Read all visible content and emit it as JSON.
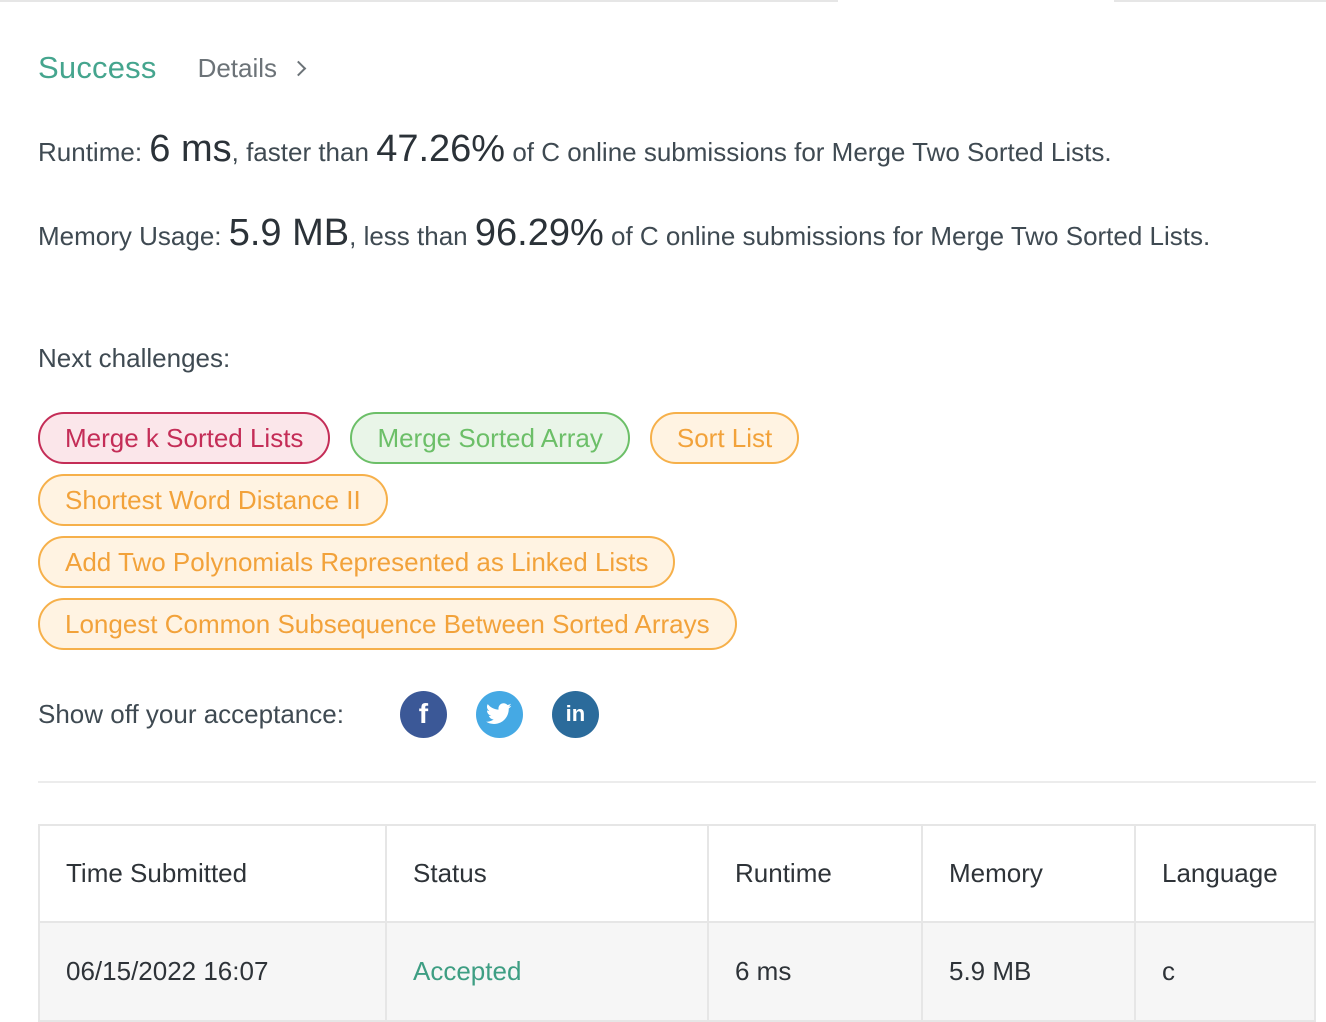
{
  "header": {
    "status": "Success",
    "details_label": "Details"
  },
  "runtime": {
    "label": "Runtime:",
    "value": "6 ms",
    "comparison": ", faster than",
    "percentile": "47.26%",
    "suffix": "of C online submissions for Merge Two Sorted Lists."
  },
  "memory": {
    "label": "Memory Usage:",
    "value": "5.9 MB",
    "comparison": ", less than",
    "percentile": "96.29%",
    "suffix": "of C online submissions for Merge Two Sorted Lists."
  },
  "next_challenges": {
    "label": "Next challenges:",
    "items": [
      {
        "label": "Merge k Sorted Lists",
        "difficulty": "hard"
      },
      {
        "label": "Merge Sorted Array",
        "difficulty": "easy"
      },
      {
        "label": "Sort List",
        "difficulty": "medium"
      },
      {
        "label": "Shortest Word Distance II",
        "difficulty": "medium"
      },
      {
        "label": "Add Two Polynomials Represented as Linked Lists",
        "difficulty": "medium"
      },
      {
        "label": "Longest Common Subsequence Between Sorted Arrays",
        "difficulty": "medium"
      }
    ]
  },
  "share": {
    "label": "Show off your acceptance:",
    "icons": [
      "facebook-icon",
      "twitter-icon",
      "linkedin-icon"
    ],
    "facebook_glyph": "f",
    "linkedin_glyph": "in"
  },
  "colors": {
    "success": "#45a58e",
    "hard": "#c42d57",
    "easy": "#6cbf68",
    "medium": "#f2a23a",
    "facebook": "#3b5897",
    "twitter": "#45a9e4",
    "linkedin": "#2b6b9b"
  },
  "submissions": {
    "columns": [
      "Time Submitted",
      "Status",
      "Runtime",
      "Memory",
      "Language"
    ],
    "rows": [
      {
        "time": "06/15/2022 16:07",
        "status": "Accepted",
        "runtime": "6 ms",
        "memory": "5.9 MB",
        "language": "c"
      }
    ]
  }
}
